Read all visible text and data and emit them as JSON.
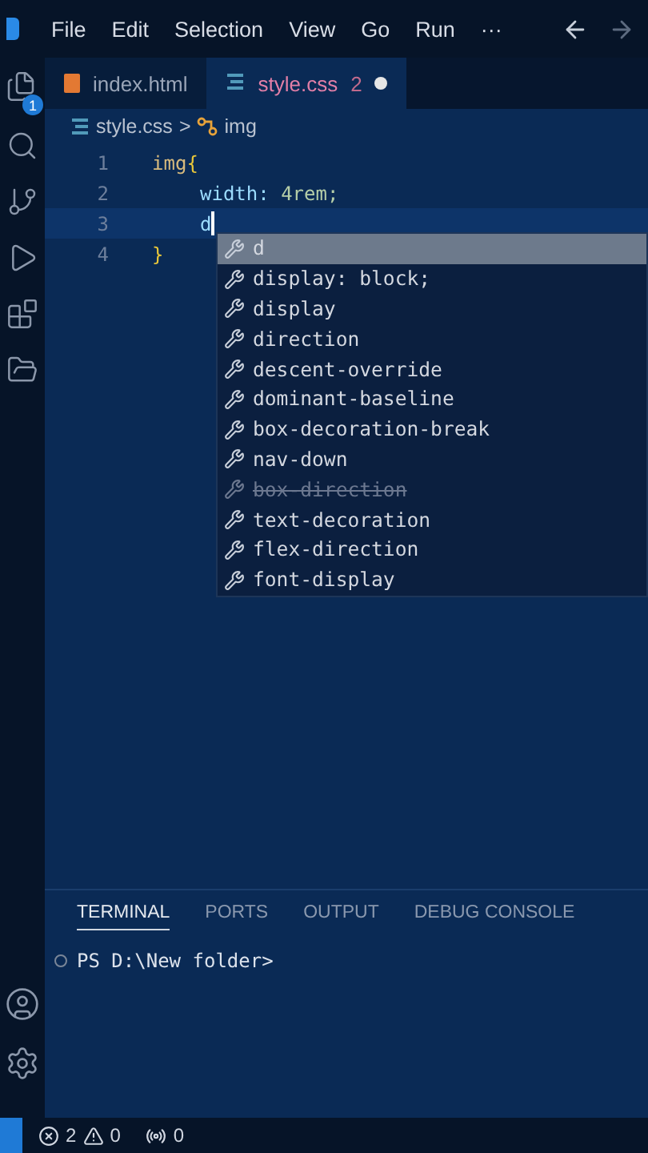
{
  "menu": [
    "File",
    "Edit",
    "Selection",
    "View",
    "Go",
    "Run",
    "···"
  ],
  "activity": {
    "explorer_badge": "1"
  },
  "tabs": [
    {
      "label": "index.html",
      "kind": "html",
      "selected": false,
      "modified": false
    },
    {
      "label": "style.css",
      "kind": "css",
      "selected": true,
      "modified": true,
      "problems": "2"
    }
  ],
  "breadcrumb": {
    "file": "style.css",
    "separator": ">",
    "symbol": "img"
  },
  "lines": [
    {
      "number": "1",
      "current": false,
      "indented": false,
      "tokens": [
        {
          "kind": "selector",
          "text": "img"
        },
        {
          "kind": "brace",
          "text": "{"
        }
      ]
    },
    {
      "number": "2",
      "current": false,
      "indented": true,
      "tokens": [
        {
          "kind": "property",
          "text": "width: "
        },
        {
          "kind": "value",
          "text": "4rem;"
        }
      ]
    },
    {
      "number": "3",
      "current": true,
      "indented": true,
      "tokens": [
        {
          "kind": "property",
          "text": "d"
        }
      ]
    },
    {
      "number": "4",
      "current": false,
      "indented": false,
      "tokens": [
        {
          "kind": "brace",
          "text": "}"
        }
      ]
    }
  ],
  "suggestions": [
    {
      "label": "d",
      "selected": true,
      "deprecated": false
    },
    {
      "label": "display: block;",
      "selected": false,
      "deprecated": false
    },
    {
      "label": "display",
      "selected": false,
      "deprecated": false
    },
    {
      "label": "direction",
      "selected": false,
      "deprecated": false
    },
    {
      "label": "descent-override",
      "selected": false,
      "deprecated": false
    },
    {
      "label": "dominant-baseline",
      "selected": false,
      "deprecated": false
    },
    {
      "label": "box-decoration-break",
      "selected": false,
      "deprecated": false
    },
    {
      "label": "nav-down",
      "selected": false,
      "deprecated": false
    },
    {
      "label": "box-direction",
      "selected": false,
      "deprecated": true
    },
    {
      "label": "text-decoration",
      "selected": false,
      "deprecated": false
    },
    {
      "label": "flex-direction",
      "selected": false,
      "deprecated": false
    },
    {
      "label": "font-display",
      "selected": false,
      "deprecated": false
    }
  ],
  "panel_tabs": [
    {
      "label": "TERMINAL",
      "selected": true
    },
    {
      "label": "PORTS",
      "selected": false
    },
    {
      "label": "OUTPUT",
      "selected": false
    },
    {
      "label": "DEBUG CONSOLE",
      "selected": false
    }
  ],
  "terminal": {
    "prompt": "PS D:\\New folder>"
  },
  "status_bar": {
    "errors": "2",
    "warnings": "0",
    "ports": "0"
  }
}
